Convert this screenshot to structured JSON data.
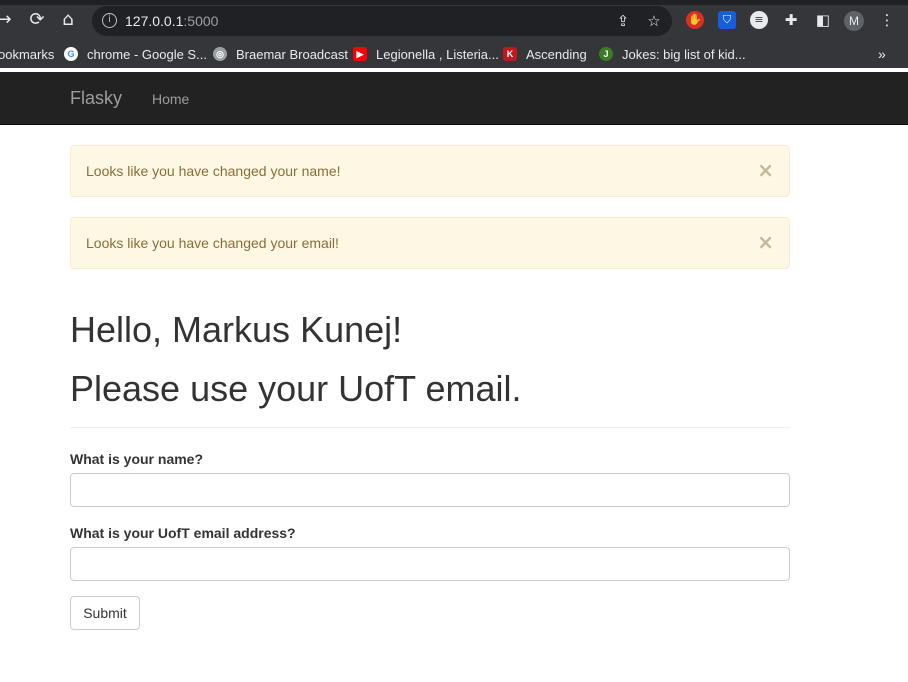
{
  "browser": {
    "url_host": "127.0.0.1",
    "url_port": ":5000",
    "avatar_initial": "M",
    "bookmarks": [
      {
        "label": "ookmarks"
      },
      {
        "label": "chrome - Google S..."
      },
      {
        "label": "Braemar Broadcast"
      },
      {
        "label": "Legionella , Listeria..."
      },
      {
        "label": "Ascending"
      },
      {
        "label": "Jokes: big list of kid..."
      }
    ],
    "more_glyph": "»"
  },
  "site": {
    "brand": "Flasky",
    "nav_home": "Home"
  },
  "alerts": [
    {
      "message": "Looks like you have changed your name!",
      "close": "×"
    },
    {
      "message": "Looks like you have changed your email!",
      "close": "×"
    }
  ],
  "page": {
    "greeting": "Hello, Markus Kunej!",
    "notice": "Please use your UofT email."
  },
  "form": {
    "name_label": "What is your name?",
    "name_value": "",
    "email_label": "What is your UofT email address?",
    "email_value": "",
    "submit_label": "Submit"
  },
  "colors": {
    "navbar_bg": "#222222",
    "alert_bg": "#fcf8e3",
    "alert_text": "#8a6d3b"
  }
}
